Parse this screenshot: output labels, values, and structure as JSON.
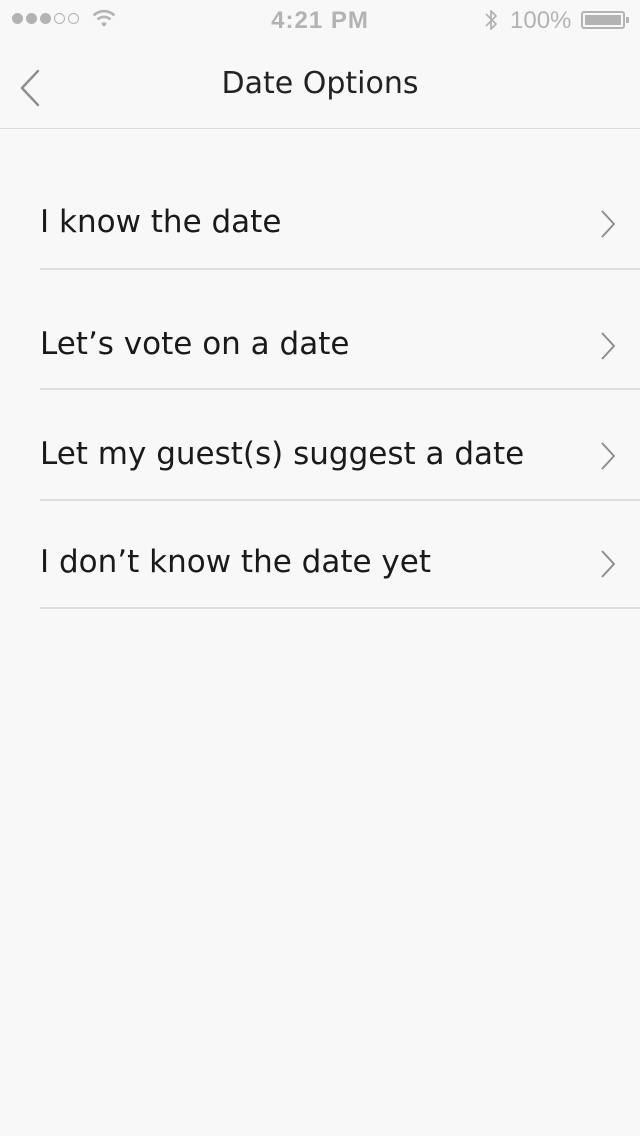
{
  "status_bar": {
    "time": "4:21 PM",
    "battery_percent": "100%",
    "signal_bars_filled": 3,
    "signal_bars_total": 5
  },
  "nav": {
    "title": "Date Options",
    "back_icon": "chevron-left-icon"
  },
  "options": [
    {
      "label": "I know the date",
      "icon": "chevron-right-icon"
    },
    {
      "label": "Let’s vote on a date",
      "icon": "chevron-right-icon"
    },
    {
      "label": "Let my guest(s) suggest a date",
      "icon": "chevron-right-icon"
    },
    {
      "label": "I don’t know the date yet",
      "icon": "chevron-right-icon"
    }
  ],
  "colors": {
    "background": "#f8f8f8",
    "text": "#1a1a1a",
    "separator": "#dedede",
    "chevron": "#8e8e8e",
    "status": "#b3b3b3"
  }
}
